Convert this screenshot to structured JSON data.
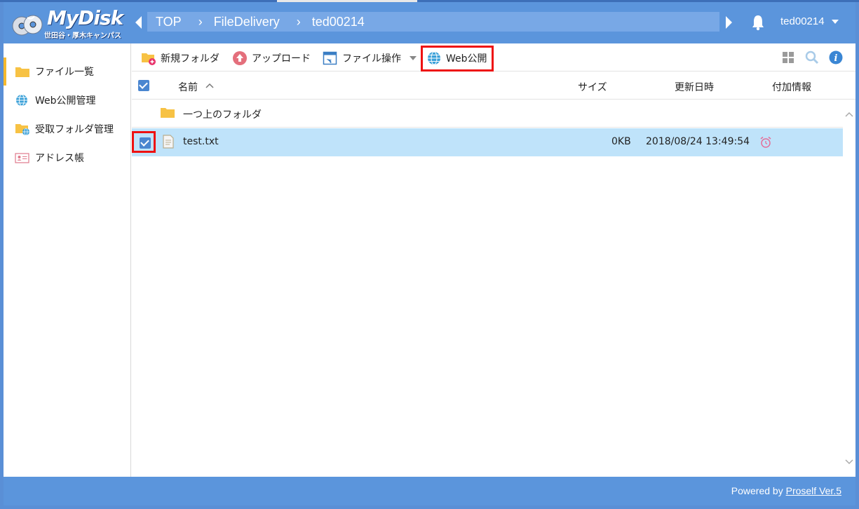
{
  "header": {
    "logo_title": "MyDisk",
    "logo_subtitle": "世田谷・厚木キャンパス",
    "breadcrumb": [
      "TOP",
      "FileDelivery",
      "ted00214"
    ],
    "user": "ted00214"
  },
  "sidebar": {
    "items": [
      {
        "label": "ファイル一覧",
        "icon": "folder-icon",
        "active": true
      },
      {
        "label": "Web公開管理",
        "icon": "globe-icon"
      },
      {
        "label": "受取フォルダ管理",
        "icon": "folder-globe-icon"
      },
      {
        "label": "アドレス帳",
        "icon": "address-card-icon"
      }
    ]
  },
  "toolbar": {
    "new_folder": "新規フォルダ",
    "upload": "アップロード",
    "file_ops": "ファイル操作",
    "web_publish": "Web公開"
  },
  "columns": {
    "name": "名前",
    "size": "サイズ",
    "updated": "更新日時",
    "extra": "付加情報"
  },
  "rows": [
    {
      "name": "一つ上のフォルダ",
      "type": "parent-folder"
    },
    {
      "name": "test.txt",
      "size": "0KB",
      "updated": "2018/08/24 13:49:54",
      "selected": true,
      "badge": "alarm-clock-icon"
    }
  ],
  "footer": {
    "prefix": "Powered by ",
    "link": "Proself Ver.5"
  },
  "colors": {
    "header_bg": "#5b95dc",
    "selected_row": "#bfe3fa",
    "highlight": "#ee1111",
    "folder": "#f7c244"
  }
}
